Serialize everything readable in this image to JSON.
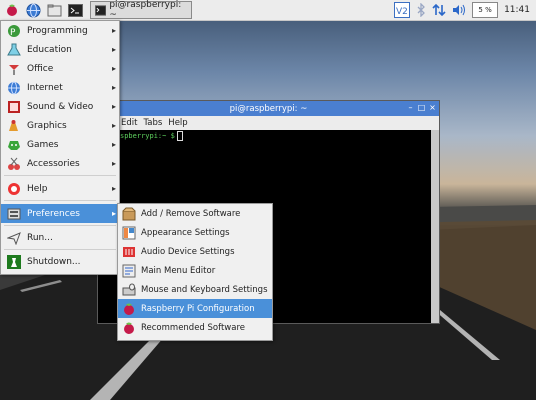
{
  "taskbar": {
    "task_title": "pi@raspberrypi: ~",
    "cpu_percent": "5 %",
    "time": "11:41",
    "icons": [
      "raspberry-menu-icon",
      "web-browser-icon",
      "file-manager-icon",
      "terminal-icon"
    ],
    "tray_icons": [
      "vnc-icon",
      "bluetooth-icon",
      "network-icon",
      "volume-icon"
    ]
  },
  "menu": {
    "items": [
      {
        "label": "Programming",
        "icon": "programming-icon",
        "submenu": true
      },
      {
        "label": "Education",
        "icon": "education-icon",
        "submenu": true
      },
      {
        "label": "Office",
        "icon": "office-icon",
        "submenu": true
      },
      {
        "label": "Internet",
        "icon": "internet-icon",
        "submenu": true
      },
      {
        "label": "Sound & Video",
        "icon": "sound-video-icon",
        "submenu": true
      },
      {
        "label": "Graphics",
        "icon": "graphics-icon",
        "submenu": true
      },
      {
        "label": "Games",
        "icon": "games-icon",
        "submenu": true
      },
      {
        "label": "Accessories",
        "icon": "accessories-icon",
        "submenu": true
      },
      {
        "label": "Help",
        "icon": "help-icon",
        "submenu": true
      },
      {
        "label": "Preferences",
        "icon": "preferences-icon",
        "submenu": true,
        "selected": true
      },
      {
        "label": "Run...",
        "icon": "run-icon",
        "submenu": false
      },
      {
        "label": "Shutdown...",
        "icon": "shutdown-icon",
        "submenu": false
      }
    ]
  },
  "submenu": {
    "items": [
      {
        "label": "Add / Remove Software",
        "icon": "add-remove-software-icon"
      },
      {
        "label": "Appearance Settings",
        "icon": "appearance-settings-icon"
      },
      {
        "label": "Audio Device Settings",
        "icon": "audio-device-settings-icon"
      },
      {
        "label": "Main Menu Editor",
        "icon": "main-menu-editor-icon"
      },
      {
        "label": "Mouse and Keyboard Settings",
        "icon": "mouse-keyboard-settings-icon"
      },
      {
        "label": "Raspberry Pi Configuration",
        "icon": "raspberry-pi-configuration-icon",
        "selected": true
      },
      {
        "label": "Recommended Software",
        "icon": "recommended-software-icon"
      }
    ]
  },
  "terminal": {
    "title": "pi@raspberrypi: ~",
    "menus": [
      "Edit",
      "Tabs",
      "Help"
    ],
    "prompt": "spberrypi:~ $"
  }
}
